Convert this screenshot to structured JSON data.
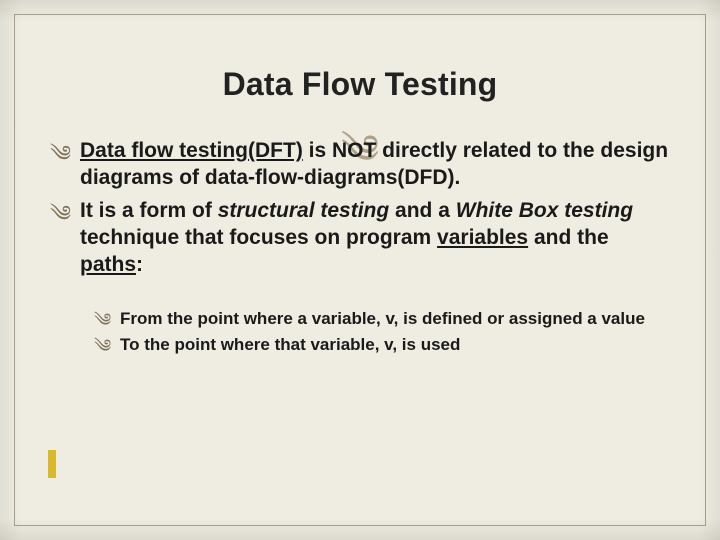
{
  "title": "Data Flow Testing",
  "flourish_glyph": "༄",
  "bullet_glyph": "༄",
  "primary": [
    {
      "segments": [
        {
          "text": "Data flow testing(DFT)",
          "underline": true,
          "bolditalic": false
        },
        {
          "text": " is NOT directly related to the design diagrams of data-flow-diagrams(DFD).",
          "underline": false,
          "bolditalic": false
        }
      ]
    },
    {
      "segments": [
        {
          "text": "It is a form of ",
          "underline": false,
          "bolditalic": false
        },
        {
          "text": "structural testing",
          "underline": false,
          "bolditalic": true
        },
        {
          "text": " and a ",
          "underline": false,
          "bolditalic": false
        },
        {
          "text": "White Box testing",
          "underline": false,
          "bolditalic": true
        },
        {
          "text": " technique that focuses on program ",
          "underline": false,
          "bolditalic": false
        },
        {
          "text": "variables",
          "underline": true,
          "bolditalic": false
        },
        {
          "text": " and the ",
          "underline": false,
          "bolditalic": false
        },
        {
          "text": "paths",
          "underline": true,
          "bolditalic": false
        },
        {
          "text": ":",
          "underline": false,
          "bolditalic": false
        }
      ]
    }
  ],
  "secondary": [
    {
      "text": "From the point where a variable, v, is defined or assigned a value"
    },
    {
      "text": "To the point where that variable, v, is used"
    }
  ]
}
